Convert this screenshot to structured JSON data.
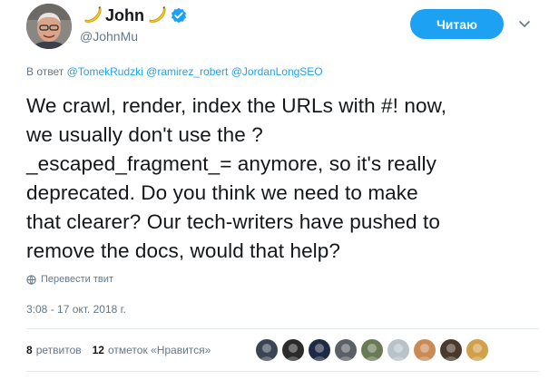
{
  "author": {
    "name": "John",
    "name_emoji": "banana-emoji",
    "handle": "@JohnMu",
    "verified": true
  },
  "follow_button": {
    "label": "Читаю"
  },
  "colors": {
    "accent": "#1da1f2",
    "text": "#14171a",
    "muted": "#657786",
    "divider": "#e6ecf0",
    "banana": "#f3c623"
  },
  "reply_to": {
    "prefix": "В ответ",
    "mentions": [
      "@TomekRudzki",
      "@ramirez_robert",
      "@JordanLongSEO"
    ]
  },
  "tweet": {
    "lines": [
      "We crawl, render, index the URLs with #! now,",
      "we usually don't use the ?",
      "_escaped_fragment_= anymore, so it's really",
      "deprecated. Do you think we need to make",
      "that clearer? Our tech-writers have pushed to",
      "remove the docs, would that help?"
    ]
  },
  "translate": {
    "label": "Перевести твит",
    "icon": "globe-icon"
  },
  "timestamp": "3:08 - 17 окт. 2018 г.",
  "stats": {
    "retweets_count": "8",
    "retweets_label": "ретвитов",
    "likes_count": "12",
    "likes_label": "отметок «Нравится»"
  },
  "likers": [
    {
      "name": "liker-avatar-1",
      "bg": "#3b4452"
    },
    {
      "name": "liker-avatar-2",
      "bg": "#2b2b2b"
    },
    {
      "name": "liker-avatar-3",
      "bg": "#1f2a44"
    },
    {
      "name": "liker-avatar-4",
      "bg": "#5b5f66"
    },
    {
      "name": "liker-avatar-5",
      "bg": "#6a7a55"
    },
    {
      "name": "liker-avatar-6",
      "bg": "#b7c2c9"
    },
    {
      "name": "liker-avatar-7",
      "bg": "#c98a55"
    },
    {
      "name": "liker-avatar-8",
      "bg": "#4a3a2c"
    },
    {
      "name": "liker-avatar-9",
      "bg": "#d1a04a"
    }
  ]
}
